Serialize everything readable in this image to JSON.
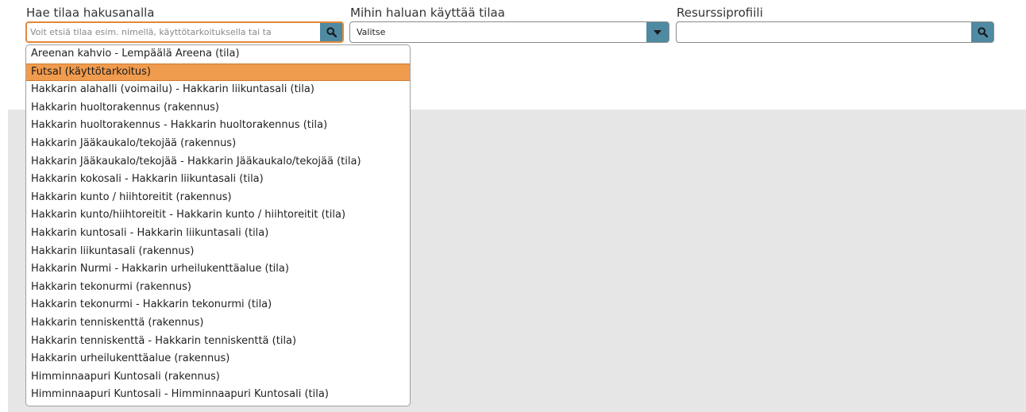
{
  "search": {
    "label": "Hae tilaa hakusanalla",
    "value": "",
    "placeholder": "Voit etsiä tilaa esim. nimellä, käyttötarkoituksella tai ta"
  },
  "usage": {
    "label": "Mihin haluan käyttää tilaa",
    "selected": "Valitse"
  },
  "resource_profile": {
    "label": "Resurssiprofiili",
    "value": ""
  },
  "colors": {
    "accent": "#4f8aa3",
    "highlight": "#f09c4e",
    "focus_border": "#e3893a",
    "background_panel": "#e6e6e6"
  },
  "icons": {
    "search_button": "search-icon",
    "select_toggle": "caret-down-icon"
  },
  "suggestions": [
    "Areenan kahvio - Lempäälä Areena (tila)",
    "Futsal (käyttötarkoitus)",
    "Hakkarin alahalli (voimailu) - Hakkarin liikuntasali (tila)",
    "Hakkarin huoltorakennus (rakennus)",
    "Hakkarin huoltorakennus - Hakkarin huoltorakennus (tila)",
    "Hakkarin Jääkaukalo/tekojää (rakennus)",
    "Hakkarin Jääkaukalo/tekojää - Hakkarin Jääkaukalo/tekojää (tila)",
    "Hakkarin kokosali - Hakkarin liikuntasali (tila)",
    "Hakkarin kunto / hiihtoreitit (rakennus)",
    "Hakkarin kunto/hiihtoreitit - Hakkarin kunto / hiihtoreitit (tila)",
    "Hakkarin kuntosali - Hakkarin liikuntasali (tila)",
    "Hakkarin liikuntasali (rakennus)",
    "Hakkarin Nurmi - Hakkarin urheilukenttäalue (tila)",
    "Hakkarin tekonurmi (rakennus)",
    "Hakkarin tekonurmi - Hakkarin tekonurmi (tila)",
    "Hakkarin tenniskenttä (rakennus)",
    "Hakkarin tenniskenttä - Hakkarin tenniskenttä (tila)",
    "Hakkarin urheilukenttäalue (rakennus)",
    "Himminnaapuri Kuntosali (rakennus)",
    "Himminnaapuri Kuntosali - Himminnaapuri Kuntosali (tila)"
  ],
  "active_index": 1
}
